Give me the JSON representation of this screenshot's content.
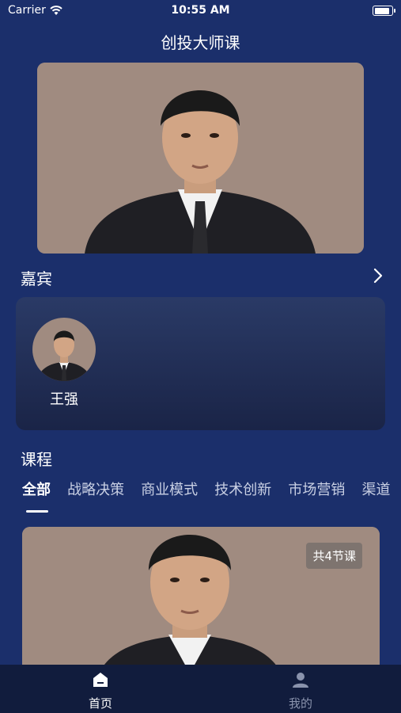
{
  "status_bar": {
    "carrier": "Carrier",
    "time": "10:55 AM",
    "battery_level": 0.9
  },
  "page": {
    "title": "创投大师课"
  },
  "guests": {
    "title": "嘉宾",
    "items": [
      {
        "name": "王强"
      }
    ]
  },
  "courses": {
    "title": "课程",
    "tabs": [
      {
        "label": "全部",
        "active": true
      },
      {
        "label": "战略决策"
      },
      {
        "label": "商业模式"
      },
      {
        "label": "技术创新"
      },
      {
        "label": "市场营销"
      },
      {
        "label": "渠道"
      }
    ],
    "items": [
      {
        "badge": "共4节课"
      }
    ]
  },
  "tabbar": {
    "home": {
      "label": "首页",
      "icon": "home-icon"
    },
    "mine": {
      "label": "我的",
      "icon": "person-icon"
    }
  },
  "colors": {
    "background": "#1b2f6b",
    "card": "#1f2b52",
    "tabbar": "#111c3d"
  }
}
